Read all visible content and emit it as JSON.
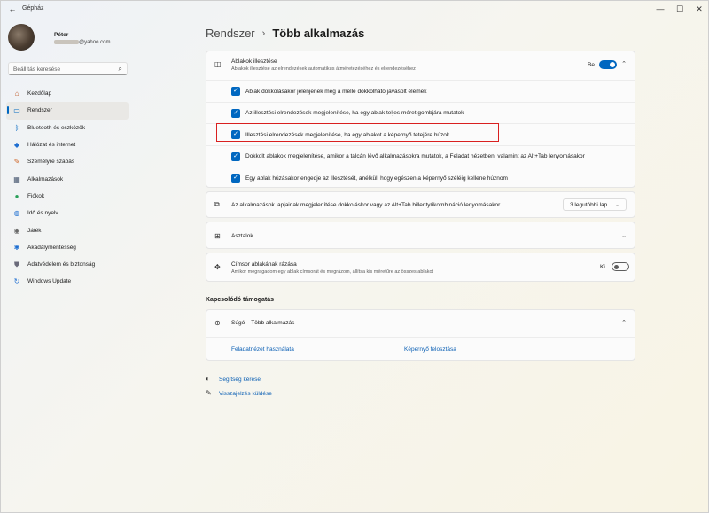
{
  "window": {
    "title": "Gépház",
    "back_glyph": "←",
    "min_glyph": "—",
    "max_glyph": "☐",
    "close_glyph": "✕"
  },
  "profile": {
    "name": "Péter",
    "email_domain": "@yahoo.com"
  },
  "search": {
    "placeholder": "Beállítás keresése",
    "icon": "search-icon",
    "icon_glyph": "⌕"
  },
  "sidebar": {
    "items": [
      {
        "label": "Kezdőlap",
        "icon": "home-icon",
        "glyph": "⌂",
        "color": "#c05a2a",
        "active": false
      },
      {
        "label": "Rendszer",
        "icon": "system-icon",
        "glyph": "▭",
        "color": "#0067c0",
        "active": true
      },
      {
        "label": "Bluetooth és eszközök",
        "icon": "bluetooth-icon",
        "glyph": "ᛒ",
        "color": "#0067c0",
        "active": false
      },
      {
        "label": "Hálózat és internet",
        "icon": "network-icon",
        "glyph": "◆",
        "color": "#1f6fd1",
        "active": false
      },
      {
        "label": "Személyre szabás",
        "icon": "brush-icon",
        "glyph": "✎",
        "color": "#d0682a",
        "active": false
      },
      {
        "label": "Alkalmazások",
        "icon": "apps-icon",
        "glyph": "▦",
        "color": "#4a5a72",
        "active": false
      },
      {
        "label": "Fiókok",
        "icon": "account-icon",
        "glyph": "●",
        "color": "#2aa05a",
        "active": false
      },
      {
        "label": "Idő és nyelv",
        "icon": "globe-icon",
        "glyph": "◍",
        "color": "#1f6fd1",
        "active": false
      },
      {
        "label": "Játék",
        "icon": "gamepad-icon",
        "glyph": "◉",
        "color": "#6a6a6a",
        "active": false
      },
      {
        "label": "Akadálymentesség",
        "icon": "accessibility-icon",
        "glyph": "✱",
        "color": "#1f6fd1",
        "active": false
      },
      {
        "label": "Adatvédelem és biztonság",
        "icon": "shield-icon",
        "glyph": "⛊",
        "color": "#6a6a7a",
        "active": false
      },
      {
        "label": "Windows Update",
        "icon": "update-icon",
        "glyph": "↻",
        "color": "#1f6fd1",
        "active": false
      }
    ]
  },
  "breadcrumb": {
    "parent": "Rendszer",
    "separator": "›",
    "current": "Több alkalmazás"
  },
  "snap": {
    "title": "Ablakok illesztése",
    "subtitle": "Ablakok illesztése az elrendezések automatikus átméretezéséhez és elrendezéséhez",
    "icon_glyph": "◫",
    "toggle_label": "Be",
    "toggle_on": true,
    "chevron": "⌃",
    "options": [
      {
        "label": "Ablak dokkolásakor jelenjenek meg a mellé dokkolható javasolt elemek",
        "checked": true
      },
      {
        "label": "Az illesztési elrendezések megjelenítése, ha egy ablak teljes méret gombjára mutatok",
        "checked": true
      },
      {
        "label": "Illesztési elrendezések megjelenítése, ha egy ablakot a képernyő tetejére húzok",
        "checked": true
      },
      {
        "label": "Dokkolt ablakok megjelenítése, amikor a tálcán lévő alkalmazásokra mutatok, a Feladat nézetben, valamint az Alt+Tab lenyomásakor",
        "checked": true
      },
      {
        "label": "Egy ablak húzásakor engedje az illesztését, anélkül, hogy egészen a képernyő széléig kellene húznom",
        "checked": true
      }
    ],
    "check_glyph": "✓"
  },
  "alttab": {
    "title": "Az alkalmazások lapjainak megjelenítése dokkoláskor vagy az Alt+Tab billentyűkombináció lenyomásakor",
    "icon_glyph": "⧉",
    "dropdown_value": "3 legutóbbi lap",
    "dropdown_chevron": "⌄"
  },
  "desktops": {
    "title": "Asztalok",
    "icon_glyph": "⊞",
    "chevron": "⌄"
  },
  "shake": {
    "title": "Címsor ablakának rázása",
    "subtitle": "Amikor megragadom egy ablak címsorát és megrázom, állítsa kis méretűre az összes ablakot",
    "icon_glyph": "✥",
    "toggle_label": "Ki",
    "toggle_on": false
  },
  "related": {
    "heading": "Kapcsolódó támogatás",
    "help_title": "Súgó – Több alkalmazás",
    "help_icon_glyph": "⊕",
    "chevron": "⌃",
    "links": [
      "Feladatnézet használata",
      "Képernyő felosztása"
    ]
  },
  "footer": {
    "get_help": "Segítség kérése",
    "feedback": "Visszajelzés küldése",
    "help_glyph": "◐",
    "feedback_glyph": "✎"
  },
  "colors": {
    "accent": "#0067c0",
    "highlight_box": "#d92020",
    "link": "#0a5fb4"
  }
}
